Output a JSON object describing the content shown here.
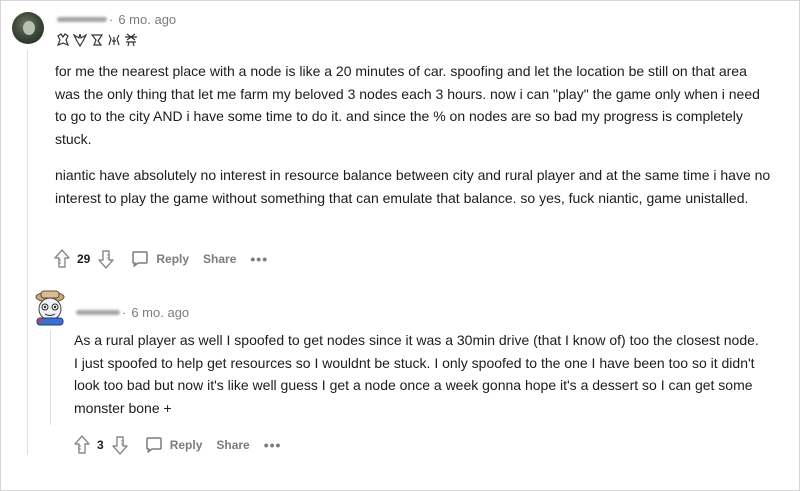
{
  "comments": [
    {
      "username": "",
      "timestamp": "6 mo. ago",
      "flair_icon": "pikmin-flair-icons",
      "paragraphs": [
        "for me the nearest place with a node is like a 20 minutes of car. spoofing and let the location be still on that area was the only thing that let me farm my beloved 3 nodes each 3 hours. now i can \"play\" the game only when i need to go to the city AND i have some time to do it. and since the % on nodes are so bad my progress is completely stuck.",
        "niantic have absolutely no interest in resource balance between city and rural player and at the same time i have no interest to play the game without something that can emulate that balance. so yes, fuck niantic, game unistalled."
      ],
      "score": "29",
      "reply_label": "Reply",
      "share_label": "Share",
      "more_label": "•••"
    },
    {
      "username": "",
      "timestamp": "6 mo. ago",
      "paragraphs": [
        "As a rural player as well I spoofed to get nodes since it was a 30min drive (that I know of) too the closest node. I just spoofed to help get resources so I wouldnt be stuck. I only spoofed to the one I have been too so it didn't look too bad but now it's like well guess I get a node once a week gonna hope it's a dessert so I can get some monster bone +"
      ],
      "score": "3",
      "reply_label": "Reply",
      "share_label": "Share",
      "more_label": "•••"
    }
  ],
  "icons": {
    "upvote": "upvote-icon",
    "downvote": "downvote-icon",
    "reply": "comment-bubble-icon",
    "more": "overflow-menu-icon"
  },
  "colors": {
    "text": "#1c1c1c",
    "meta": "#7c7c7c",
    "thread_line": "#e0e0e0"
  }
}
